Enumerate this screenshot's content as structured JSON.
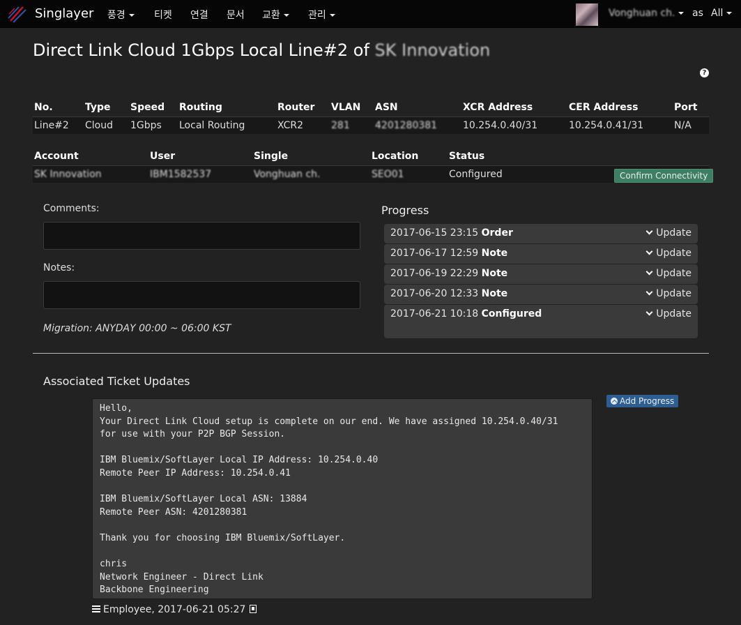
{
  "navbar": {
    "brand": "Singlayer",
    "menu": [
      {
        "label": "풍경",
        "dropdown": true
      },
      {
        "label": "티켓",
        "dropdown": false
      },
      {
        "label": "연결",
        "dropdown": false
      },
      {
        "label": "문서",
        "dropdown": false
      },
      {
        "label": "교환",
        "dropdown": true
      },
      {
        "label": "관리",
        "dropdown": true
      }
    ],
    "user_name": "Vonghuan ch.",
    "as_label": "as",
    "scope": "All"
  },
  "page": {
    "title_prefix": "Direct Link Cloud 1Gbps Local Line#2 of",
    "title_account": "SK Innovation",
    "help_icon": "question-circle-icon"
  },
  "line_table": {
    "headers": [
      "No.",
      "Type",
      "Speed",
      "Routing",
      "Router",
      "VLAN",
      "ASN",
      "XCR Address",
      "CER Address",
      "Port"
    ],
    "row": {
      "no": "Line#2",
      "type": "Cloud",
      "speed": "1Gbps",
      "routing": "Local Routing",
      "router": "XCR2",
      "vlan": "281",
      "asn": "4201280381",
      "xcr_address": "10.254.0.40/31",
      "cer_address": "10.254.0.41/31",
      "port": "N/A"
    }
  },
  "account_table": {
    "headers": [
      "Account",
      "User",
      "Single",
      "Location",
      "Status"
    ],
    "row": {
      "account": "SK Innovation",
      "user": "IBM1582537",
      "single": "Vonghuan ch.",
      "location": "SEO01",
      "status": "Configured"
    },
    "confirm_button": "Confirm Connectivity"
  },
  "form": {
    "comments_label": "Comments:",
    "comments_value": "",
    "notes_label": "Notes:",
    "notes_value": "",
    "migration": "Migration: ANYDAY 00:00 ~ 06:00 KST"
  },
  "progress": {
    "title": "Progress",
    "items": [
      {
        "date": "2017-06-15 23:15",
        "event": "Order",
        "action": "Update"
      },
      {
        "date": "2017-06-17 12:59",
        "event": "Note",
        "action": "Update"
      },
      {
        "date": "2017-06-19 22:29",
        "event": "Note",
        "action": "Update"
      },
      {
        "date": "2017-06-20 12:33",
        "event": "Note",
        "action": "Update"
      },
      {
        "date": "2017-06-21 10:18",
        "event": "Configured",
        "action": "Update"
      }
    ]
  },
  "ticket": {
    "title": "Associated Ticket Updates",
    "add_progress": "Add Progress",
    "body": "Hello,\nYour Direct Link Cloud setup is complete on our end. We have assigned 10.254.0.40/31\nfor use with your P2P BGP Session.\n\nIBM Bluemix/SoftLayer Local IP Address: 10.254.0.40\nRemote Peer IP Address: 10.254.0.41\n\nIBM Bluemix/SoftLayer Local ASN: 13884\nRemote Peer ASN: 4201280381\n\nThank you for choosing IBM Bluemix/SoftLayer.\n\nchris\nNetwork Engineer - Direct Link\nBackbone Engineering",
    "footer": "Employee, 2017-06-21 05:27"
  },
  "colors": {
    "background": "#222222",
    "navbar": "#060606",
    "confirm_button": "#3e7e63",
    "add_button": "#2e5e91",
    "panel": "#3a3a3a"
  }
}
